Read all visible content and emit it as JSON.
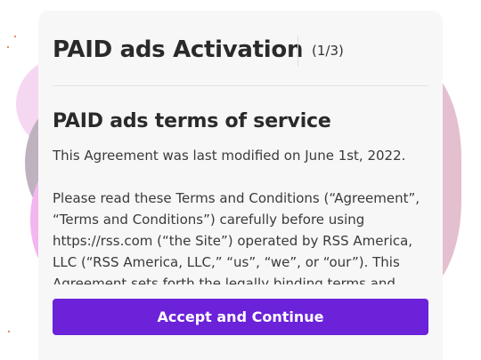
{
  "modal": {
    "title": "PAID ads Activation",
    "step": "(1/3)",
    "heading": "PAID ads terms of service",
    "paragraphs": [
      "This Agreement was last modified on June 1st, 2022.",
      "Please read these Terms and Conditions (“Agreement”, “Terms and Conditions”) carefully before using https://rss.com (“the Site”) operated by RSS America, LLC (“RSS America, LLC,” “us”, “we”, or “our”). This Agreement sets forth the legally binding terms and conditions for"
    ],
    "accept_label": "Accept and Continue"
  },
  "colors": {
    "accent": "#6c22d9",
    "modal_bg": "#f7f7f7",
    "text": "#2a2a2a"
  }
}
